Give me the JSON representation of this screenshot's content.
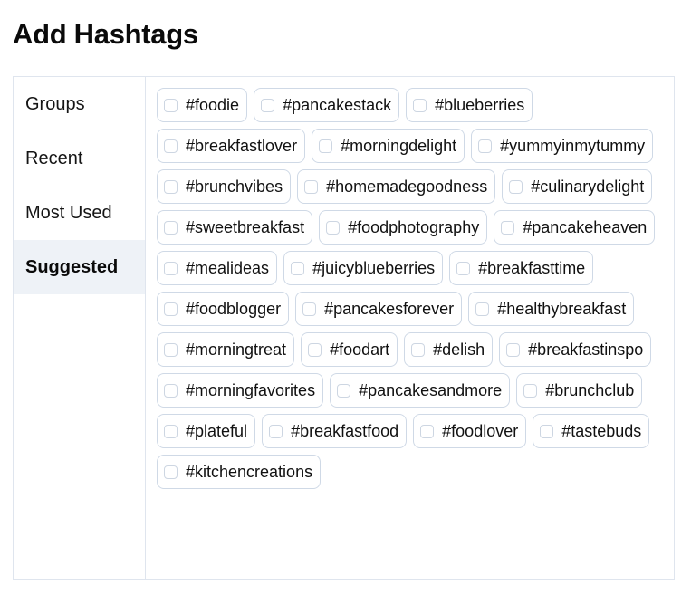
{
  "header": {
    "title": "Add Hashtags"
  },
  "sidebar": {
    "items": [
      {
        "label": "Groups",
        "active": false
      },
      {
        "label": "Recent",
        "active": false
      },
      {
        "label": "Most Used",
        "active": false
      },
      {
        "label": "Suggested",
        "active": true
      }
    ]
  },
  "hashtags": {
    "checked_color": "#cfd9e6",
    "items": [
      {
        "label": "#foodie",
        "checked": false
      },
      {
        "label": "#pancakestack",
        "checked": false
      },
      {
        "label": "#blueberries",
        "checked": false
      },
      {
        "label": "#breakfastlover",
        "checked": false
      },
      {
        "label": "#morningdelight",
        "checked": false
      },
      {
        "label": "#yummyinmytummy",
        "checked": false
      },
      {
        "label": "#brunchvibes",
        "checked": false
      },
      {
        "label": "#homemadegoodness",
        "checked": false
      },
      {
        "label": "#culinarydelight",
        "checked": false
      },
      {
        "label": "#sweetbreakfast",
        "checked": false
      },
      {
        "label": "#foodphotography",
        "checked": false
      },
      {
        "label": "#pancakeheaven",
        "checked": false
      },
      {
        "label": "#mealideas",
        "checked": false
      },
      {
        "label": "#juicyblueberries",
        "checked": false
      },
      {
        "label": "#breakfasttime",
        "checked": false
      },
      {
        "label": "#foodblogger",
        "checked": false
      },
      {
        "label": "#pancakesforever",
        "checked": false
      },
      {
        "label": "#healthybreakfast",
        "checked": false
      },
      {
        "label": "#morningtreat",
        "checked": false
      },
      {
        "label": "#foodart",
        "checked": false
      },
      {
        "label": "#delish",
        "checked": false
      },
      {
        "label": "#breakfastinspo",
        "checked": false
      },
      {
        "label": "#morningfavorites",
        "checked": false
      },
      {
        "label": "#pancakesandmore",
        "checked": false
      },
      {
        "label": "#brunchclub",
        "checked": false
      },
      {
        "label": "#plateful",
        "checked": false
      },
      {
        "label": "#breakfastfood",
        "checked": false
      },
      {
        "label": "#foodlover",
        "checked": false
      },
      {
        "label": "#tastebuds",
        "checked": false
      },
      {
        "label": "#kitchencreations",
        "checked": false
      }
    ]
  }
}
